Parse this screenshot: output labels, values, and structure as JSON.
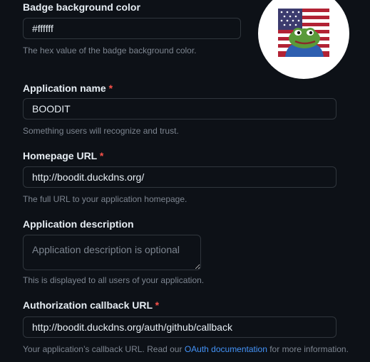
{
  "badge": {
    "label": "Badge background color",
    "value": "#ffffff",
    "note": "The hex value of the badge background color.",
    "logo_icon": "american-flag-frog-logo",
    "preview_bg": "#ffffff"
  },
  "app_name": {
    "label": "Application name",
    "required_mark": "*",
    "value": "BOODIT",
    "note": "Something users will recognize and trust."
  },
  "homepage": {
    "label": "Homepage URL",
    "required_mark": "*",
    "value": "http://boodit.duckdns.org/",
    "note": "The full URL to your application homepage."
  },
  "description": {
    "label": "Application description",
    "placeholder": "Application description is optional",
    "value": "",
    "note": "This is displayed to all users of your application."
  },
  "callback": {
    "label": "Authorization callback URL",
    "required_mark": "*",
    "value": "http://boodit.duckdns.org/auth/github/callback",
    "note_prefix": "Your application’s callback URL. Read our ",
    "note_link": "OAuth documentation",
    "note_suffix": " for more information."
  },
  "colors": {
    "background": "#0d1117",
    "border": "#30363d",
    "text": "#e6edf3",
    "muted": "#7d8590",
    "required": "#f85149",
    "link": "#4493f8"
  }
}
